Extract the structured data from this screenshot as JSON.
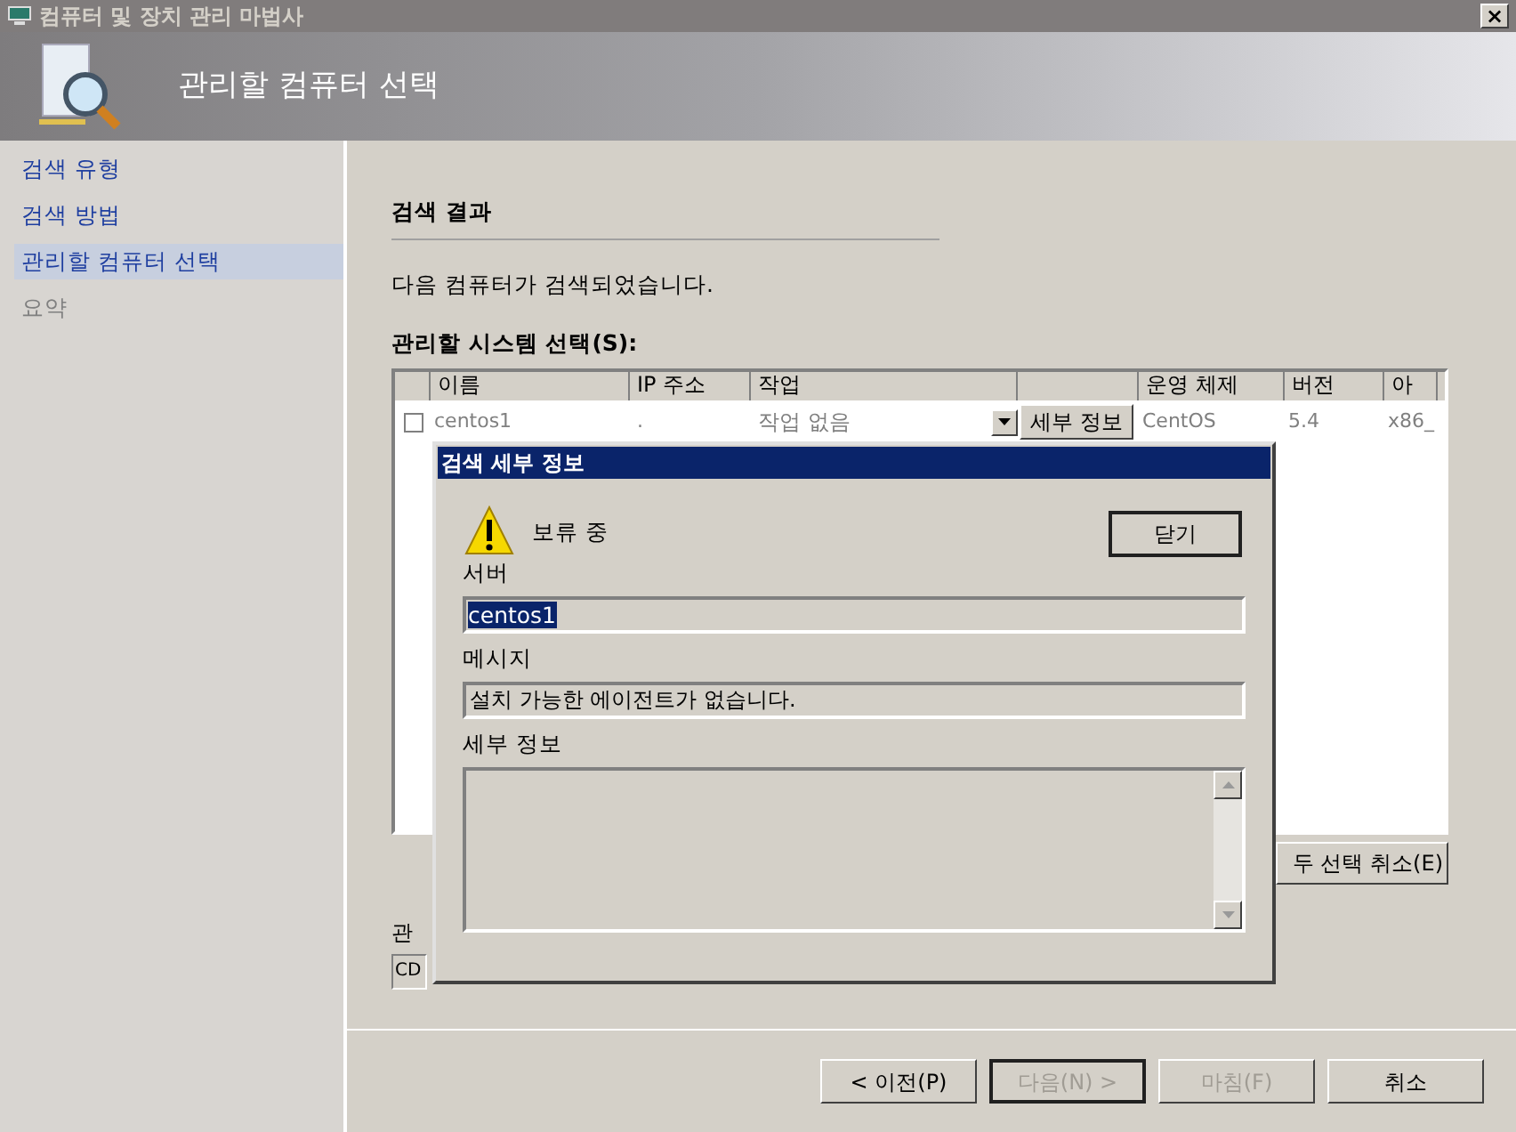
{
  "window": {
    "title": "컴퓨터 및 장치 관리 마법사",
    "close": "×"
  },
  "header": {
    "title": "관리할 컴퓨터 선택"
  },
  "sidebar": {
    "items": [
      {
        "label": "검색 유형",
        "selected": false,
        "disabled": false
      },
      {
        "label": "검색 방법",
        "selected": false,
        "disabled": false
      },
      {
        "label": "관리할 컴퓨터 선택",
        "selected": true,
        "disabled": false
      },
      {
        "label": "요약",
        "selected": false,
        "disabled": true
      }
    ]
  },
  "section": {
    "title": "검색 결과",
    "message": "다음 컴퓨터가 검색되었습니다.",
    "list_label": "관리할 시스템 선택(S):"
  },
  "table": {
    "columns": [
      "이름",
      "IP 주소",
      "작업",
      "",
      "운영 체제",
      "버전",
      "아"
    ],
    "rows": [
      {
        "checked": false,
        "name": "centos1",
        "ip": ".",
        "task": "작업 없음",
        "details_button": "세부 정보",
        "os": "CentOS",
        "version": "5.4",
        "arch": "x86_"
      }
    ]
  },
  "deselect_button": "두 선택 취소(E)",
  "manage_label": "관",
  "manage_field": "CD",
  "dialog": {
    "title": "검색 세부 정보",
    "status": "보류 중",
    "close_button": "닫기",
    "server_label": "서버",
    "server_value": "centos1",
    "message_label": "메시지",
    "message_value": "설치 가능한 에이전트가 없습니다.",
    "details_label": "세부 정보"
  },
  "buttons": [
    {
      "label": "< 이전(P)",
      "disabled": false,
      "default": false
    },
    {
      "label": "다음(N) >",
      "disabled": true,
      "default": true
    },
    {
      "label": "마침(F)",
      "disabled": true,
      "default": false
    },
    {
      "label": "취소",
      "disabled": false,
      "default": false
    }
  ]
}
